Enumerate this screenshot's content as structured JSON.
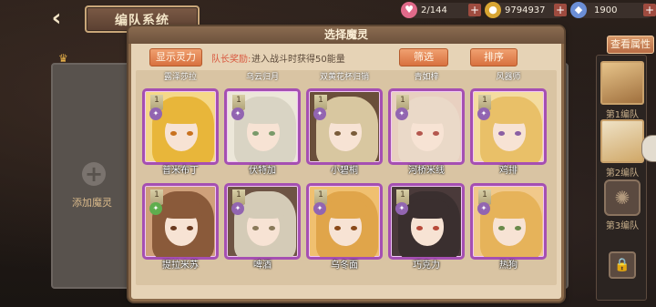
{
  "header": {
    "title": "编队系统",
    "back_icon": "back-arrow-icon"
  },
  "resources": [
    {
      "name": "stamina",
      "icon": "heart-icon",
      "value": "2/144",
      "color": "#e06a8a"
    },
    {
      "name": "gold",
      "icon": "coin-icon",
      "value": "9794937",
      "color": "#d8a532"
    },
    {
      "name": "gem",
      "icon": "gem-icon",
      "value": "1900",
      "color": "#6b8ed6"
    }
  ],
  "view_attributes_label": "查看属性",
  "left_slot": {
    "add_label": "添加魔灵"
  },
  "teams": [
    {
      "label": "第1编队"
    },
    {
      "label": "第2编队"
    },
    {
      "label": "第3编队"
    }
  ],
  "modal": {
    "title": "选择魔灵",
    "show_power_label": "显示灵力",
    "captain_bonus_label": "队长奖励:",
    "captain_bonus_text": "进入战斗时获得50能量",
    "filter_label": "筛选",
    "sort_label": "排序",
    "top_row_names": [
      "露泽莎拉",
      "乌云归月",
      "双黄花杯归销",
      "青如梓",
      "风器师"
    ],
    "cards": [
      {
        "name": "普米布丁",
        "level": "1",
        "element": "purple",
        "hair": "#e8b63a",
        "eye": "#c9721f",
        "bg": "#f5d888"
      },
      {
        "name": "伏特加",
        "level": "1",
        "element": "purple",
        "hair": "#d9d4c4",
        "eye": "#7a9a6a",
        "bg": "#ece7d9"
      },
      {
        "name": "小碧桐",
        "level": "1",
        "element": "purple",
        "hair": "#d8c7a0",
        "eye": "#7a5c3a",
        "bg": "#6a4f3a"
      },
      {
        "name": "河桥米线",
        "level": "1",
        "element": "purple",
        "hair": "#ead9c8",
        "eye": "#b4574e",
        "bg": "#e8d0c0"
      },
      {
        "name": "鸡排",
        "level": "1",
        "element": "purple",
        "hair": "#e9c068",
        "eye": "#8a5fa3",
        "bg": "#f4dca0"
      },
      {
        "name": "提拉米苏",
        "level": "1",
        "element": "green",
        "hair": "#8a5a3a",
        "eye": "#6a3a20",
        "bg": "#cfa07a"
      },
      {
        "name": "啤酒",
        "level": "1",
        "element": "purple",
        "hair": "#d4cbb7",
        "eye": "#8a7a5a",
        "bg": "#6e5444"
      },
      {
        "name": "乌冬面",
        "level": "1",
        "element": "purple",
        "hair": "#e0a54a",
        "eye": "#8a4a1a",
        "bg": "#f0c070"
      },
      {
        "name": "巧克力",
        "level": "1",
        "element": "purple",
        "hair": "#3a2f2f",
        "eye": "#b84a3a",
        "bg": "#4a3a3a"
      },
      {
        "name": "热狗",
        "level": "1",
        "element": "purple",
        "hair": "#e6b35a",
        "eye": "#6a8a4a",
        "bg": "#f1c98a"
      }
    ]
  }
}
